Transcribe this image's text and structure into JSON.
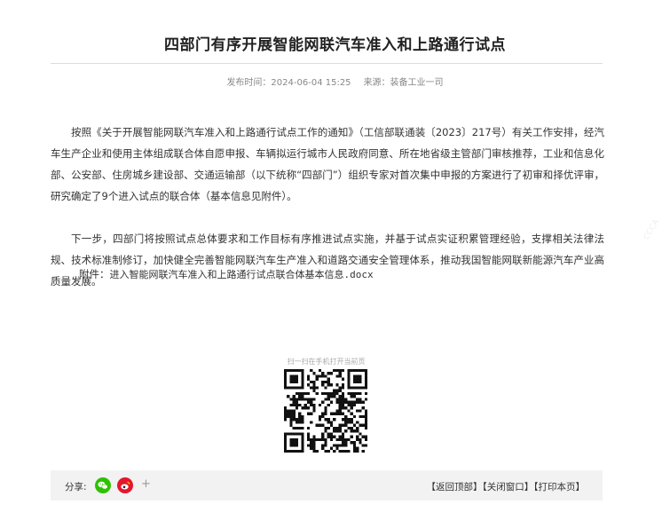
{
  "article": {
    "title": "四部门有序开展智能网联汽车准入和上路通行试点",
    "published_label": "发布时间：2024-06-04 15:25",
    "source_label": "来源：装备工业一司",
    "paragraphs": [
      "按照《关于开展智能网联汽车准入和上路通行试点工作的通知》（工信部联通装〔2023〕217号）有关工作安排，经汽车生产企业和使用主体组成联合体自愿申报、车辆拟运行城市人民政府同意、所在地省级主管部门审核推荐，工业和信息化部、公安部、住房城乡建设部、交通运输部（以下统称“四部门”）组织专家对首次集中申报的方案进行了初审和择优评审，研究确定了9个进入试点的联合体（基本信息见附件）。",
      "下一步，四部门将按照试点总体要求和工作目标有序推进试点实施，并基于试点实证积累管理经验，支撑相关法律法规、技术标准制修订，加快健全完善智能网联汽车生产准入和道路交通安全管理体系，推动我国智能网联新能源汽车产业高质量发展。"
    ],
    "attachment_label": "附件：",
    "attachment_file": "进入智能网联汽车准入和上路通行试点联合体基本信息.docx"
  },
  "qr": {
    "caption": "扫一扫在手机打开当前页"
  },
  "footer": {
    "share_label": "分享:",
    "share_icons": [
      "wechat-icon",
      "weibo-icon"
    ],
    "plus": "+",
    "back_top": "【返回顶部】",
    "close_window": "【关闭窗口】",
    "print_page": "【打印本页】"
  },
  "colors": {
    "wechat": "#2dc100",
    "weibo": "#e6162d",
    "footer_bg": "#f2f2f2"
  }
}
